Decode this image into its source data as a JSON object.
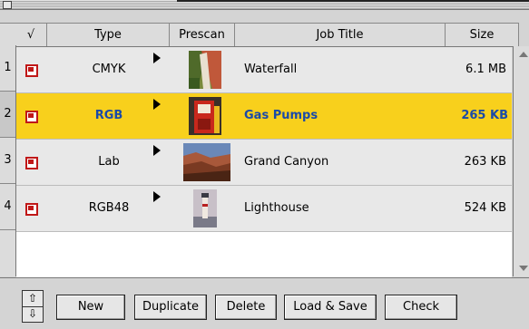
{
  "header": {
    "check": "√",
    "type": "Type",
    "prescan": "Prescan",
    "job_title": "Job Title",
    "size": "Size"
  },
  "rows": [
    {
      "num": "1",
      "type": "CMYK",
      "title": "Waterfall",
      "size": "6.1 MB",
      "thumb": "waterfall"
    },
    {
      "num": "2",
      "type": "RGB",
      "title": "Gas Pumps",
      "size": "265 KB",
      "thumb": "gas-pumps"
    },
    {
      "num": "3",
      "type": "Lab",
      "title": "Grand Canyon",
      "size": "263 KB",
      "thumb": "grand-canyon"
    },
    {
      "num": "4",
      "type": "RGB48",
      "title": "Lighthouse",
      "size": "524 KB",
      "thumb": "lighthouse"
    }
  ],
  "buttons": {
    "new": "New",
    "duplicate": "Duplicate",
    "delete": "Delete",
    "load_save": "Load & Save",
    "check": "Check"
  },
  "updown": {
    "up": "⇧",
    "down": "⇩"
  },
  "colors": {
    "selection": "#f8d01c",
    "selected_text": "#1a4aa8",
    "checkbox": "#c01818"
  }
}
